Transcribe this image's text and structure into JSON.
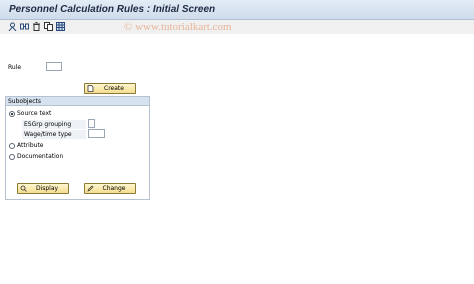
{
  "window": {
    "title": "Personnel Calculation Rules : Initial Screen",
    "watermark": "© www.tutorialkart.com"
  },
  "toolbar": {
    "icons": [
      "other-object-icon",
      "where-used-icon",
      "delete-icon",
      "copy-icon",
      "overview-icon"
    ]
  },
  "form": {
    "rule_label": "Rule",
    "rule_value": "",
    "create_label": "Create"
  },
  "subobjects": {
    "title": "Subobjects",
    "source_text_label": "Source text",
    "source_text_selected": true,
    "esgrp_label": "ESGrp grouping",
    "esgrp_value": "",
    "wage_type_label": "Wage/time type",
    "wage_type_value": "",
    "attribute_label": "Attribute",
    "documentation_label": "Documentation",
    "display_label": "Display",
    "change_label": "Change"
  }
}
